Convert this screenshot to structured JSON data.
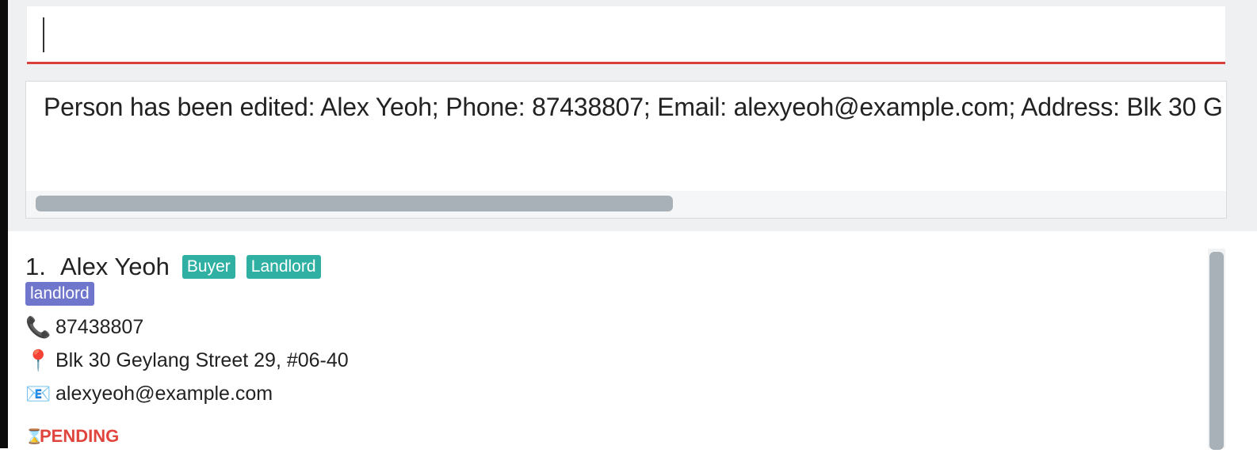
{
  "command": {
    "value": ""
  },
  "result": {
    "message": "Person has been edited: Alex Yeoh; Phone: 87438807; Email: alexyeoh@example.com; Address: Blk 30 G"
  },
  "persons": [
    {
      "index": "1.",
      "name": "Alex Yeoh",
      "tags": [
        "Buyer",
        "Landlord"
      ],
      "secondary_tags": [
        "landlord"
      ],
      "phone": "87438807",
      "address": "Blk 30 Geylang Street 29, #06-40",
      "email": "alexyeoh@example.com",
      "status": "PENDING",
      "icons": {
        "phone": "phone-icon",
        "address": "map-pin-icon",
        "email": "envelope-icon",
        "status": "hourglass-icon"
      }
    }
  ],
  "colors": {
    "command_underline": "#d9403a",
    "tag_teal": "#2fb0a3",
    "tag_purple": "#7076cc",
    "status_pending": "#e0443d"
  }
}
